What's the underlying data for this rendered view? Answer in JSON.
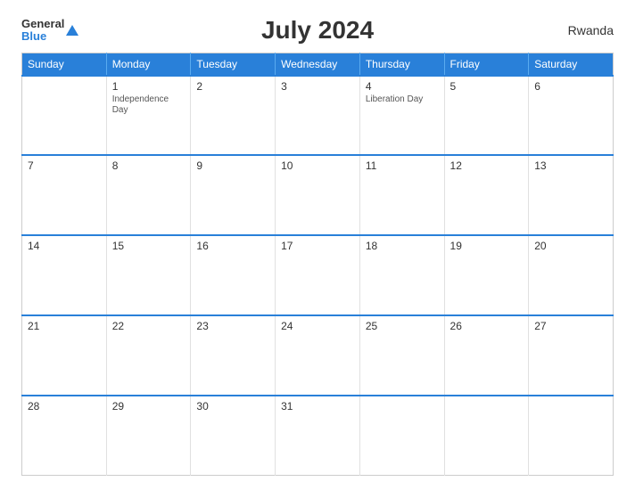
{
  "header": {
    "title": "July 2024",
    "country": "Rwanda",
    "logo_general": "General",
    "logo_blue": "Blue"
  },
  "days_of_week": [
    "Sunday",
    "Monday",
    "Tuesday",
    "Wednesday",
    "Thursday",
    "Friday",
    "Saturday"
  ],
  "weeks": [
    [
      {
        "day": "",
        "holiday": "",
        "empty": true
      },
      {
        "day": "1",
        "holiday": "Independence Day",
        "empty": false
      },
      {
        "day": "2",
        "holiday": "",
        "empty": false
      },
      {
        "day": "3",
        "holiday": "",
        "empty": false
      },
      {
        "day": "4",
        "holiday": "Liberation Day",
        "empty": false
      },
      {
        "day": "5",
        "holiday": "",
        "empty": false
      },
      {
        "day": "6",
        "holiday": "",
        "empty": false
      }
    ],
    [
      {
        "day": "7",
        "holiday": "",
        "empty": false
      },
      {
        "day": "8",
        "holiday": "",
        "empty": false
      },
      {
        "day": "9",
        "holiday": "",
        "empty": false
      },
      {
        "day": "10",
        "holiday": "",
        "empty": false
      },
      {
        "day": "11",
        "holiday": "",
        "empty": false
      },
      {
        "day": "12",
        "holiday": "",
        "empty": false
      },
      {
        "day": "13",
        "holiday": "",
        "empty": false
      }
    ],
    [
      {
        "day": "14",
        "holiday": "",
        "empty": false
      },
      {
        "day": "15",
        "holiday": "",
        "empty": false
      },
      {
        "day": "16",
        "holiday": "",
        "empty": false
      },
      {
        "day": "17",
        "holiday": "",
        "empty": false
      },
      {
        "day": "18",
        "holiday": "",
        "empty": false
      },
      {
        "day": "19",
        "holiday": "",
        "empty": false
      },
      {
        "day": "20",
        "holiday": "",
        "empty": false
      }
    ],
    [
      {
        "day": "21",
        "holiday": "",
        "empty": false
      },
      {
        "day": "22",
        "holiday": "",
        "empty": false
      },
      {
        "day": "23",
        "holiday": "",
        "empty": false
      },
      {
        "day": "24",
        "holiday": "",
        "empty": false
      },
      {
        "day": "25",
        "holiday": "",
        "empty": false
      },
      {
        "day": "26",
        "holiday": "",
        "empty": false
      },
      {
        "day": "27",
        "holiday": "",
        "empty": false
      }
    ],
    [
      {
        "day": "28",
        "holiday": "",
        "empty": false
      },
      {
        "day": "29",
        "holiday": "",
        "empty": false
      },
      {
        "day": "30",
        "holiday": "",
        "empty": false
      },
      {
        "day": "31",
        "holiday": "",
        "empty": false
      },
      {
        "day": "",
        "holiday": "",
        "empty": true
      },
      {
        "day": "",
        "holiday": "",
        "empty": true
      },
      {
        "day": "",
        "holiday": "",
        "empty": true
      }
    ]
  ]
}
